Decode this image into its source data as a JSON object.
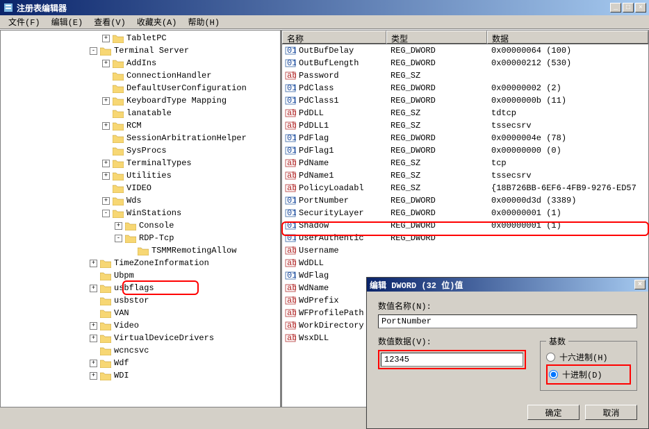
{
  "window": {
    "title": "注册表编辑器"
  },
  "menu": {
    "file": "文件(F)",
    "edit": "编辑(E)",
    "view": "查看(V)",
    "favorites": "收藏夹(A)",
    "help": "帮助(H)"
  },
  "columns": {
    "name": "名称",
    "type": "类型",
    "data": "数据"
  },
  "tree": [
    {
      "indent": 8,
      "exp": "+",
      "label": "TabletPC"
    },
    {
      "indent": 7,
      "exp": "-",
      "label": "Terminal Server"
    },
    {
      "indent": 8,
      "exp": "+",
      "label": "AddIns"
    },
    {
      "indent": 8,
      "exp": "",
      "label": "ConnectionHandler"
    },
    {
      "indent": 8,
      "exp": "",
      "label": "DefaultUserConfiguration"
    },
    {
      "indent": 8,
      "exp": "+",
      "label": "KeyboardType Mapping"
    },
    {
      "indent": 8,
      "exp": "",
      "label": "lanatable"
    },
    {
      "indent": 8,
      "exp": "+",
      "label": "RCM"
    },
    {
      "indent": 8,
      "exp": "",
      "label": "SessionArbitrationHelper"
    },
    {
      "indent": 8,
      "exp": "",
      "label": "SysProcs"
    },
    {
      "indent": 8,
      "exp": "+",
      "label": "TerminalTypes"
    },
    {
      "indent": 8,
      "exp": "+",
      "label": "Utilities"
    },
    {
      "indent": 8,
      "exp": "",
      "label": "VIDEO"
    },
    {
      "indent": 8,
      "exp": "+",
      "label": "Wds"
    },
    {
      "indent": 8,
      "exp": "-",
      "label": "WinStations"
    },
    {
      "indent": 9,
      "exp": "+",
      "label": "Console"
    },
    {
      "indent": 9,
      "exp": "-",
      "label": "RDP-Tcp"
    },
    {
      "indent": 10,
      "exp": "",
      "label": "TSMMRemotingAllow"
    },
    {
      "indent": 7,
      "exp": "+",
      "label": "TimeZoneInformation"
    },
    {
      "indent": 7,
      "exp": "",
      "label": "Ubpm"
    },
    {
      "indent": 7,
      "exp": "+",
      "label": "usbflags"
    },
    {
      "indent": 7,
      "exp": "",
      "label": "usbstor"
    },
    {
      "indent": 7,
      "exp": "",
      "label": "VAN"
    },
    {
      "indent": 7,
      "exp": "+",
      "label": "Video"
    },
    {
      "indent": 7,
      "exp": "+",
      "label": "VirtualDeviceDrivers"
    },
    {
      "indent": 7,
      "exp": "",
      "label": "wcncsvc"
    },
    {
      "indent": 7,
      "exp": "+",
      "label": "Wdf"
    },
    {
      "indent": 7,
      "exp": "+",
      "label": "WDI"
    }
  ],
  "values": [
    {
      "icon": "dword",
      "name": "OutBufDelay",
      "type": "REG_DWORD",
      "data": "0x00000064 (100)"
    },
    {
      "icon": "dword",
      "name": "OutBufLength",
      "type": "REG_DWORD",
      "data": "0x00000212 (530)"
    },
    {
      "icon": "sz",
      "name": "Password",
      "type": "REG_SZ",
      "data": ""
    },
    {
      "icon": "dword",
      "name": "PdClass",
      "type": "REG_DWORD",
      "data": "0x00000002 (2)"
    },
    {
      "icon": "dword",
      "name": "PdClass1",
      "type": "REG_DWORD",
      "data": "0x0000000b (11)"
    },
    {
      "icon": "sz",
      "name": "PdDLL",
      "type": "REG_SZ",
      "data": "tdtcp"
    },
    {
      "icon": "sz",
      "name": "PdDLL1",
      "type": "REG_SZ",
      "data": "tssecsrv"
    },
    {
      "icon": "dword",
      "name": "PdFlag",
      "type": "REG_DWORD",
      "data": "0x0000004e (78)"
    },
    {
      "icon": "dword",
      "name": "PdFlag1",
      "type": "REG_DWORD",
      "data": "0x00000000 (0)"
    },
    {
      "icon": "sz",
      "name": "PdName",
      "type": "REG_SZ",
      "data": "tcp"
    },
    {
      "icon": "sz",
      "name": "PdName1",
      "type": "REG_SZ",
      "data": "tssecsrv"
    },
    {
      "icon": "sz",
      "name": "PolicyLoadabl",
      "type": "REG_SZ",
      "data": "{18B726BB-6EF6-4FB9-9276-ED57"
    },
    {
      "icon": "dword",
      "name": "PortNumber",
      "type": "REG_DWORD",
      "data": "0x00000d3d (3389)"
    },
    {
      "icon": "dword",
      "name": "SecurityLayer",
      "type": "REG_DWORD",
      "data": "0x00000001 (1)"
    },
    {
      "icon": "dword",
      "name": "Shadow",
      "type": "REG_DWORD",
      "data": "0x00000001 (1)"
    },
    {
      "icon": "dword",
      "name": "UserAuthentic",
      "type": "REG_DWORD",
      "data": ""
    },
    {
      "icon": "sz",
      "name": "Username",
      "type": "",
      "data": ""
    },
    {
      "icon": "sz",
      "name": "WdDLL",
      "type": "",
      "data": ""
    },
    {
      "icon": "dword",
      "name": "WdFlag",
      "type": "",
      "data": ""
    },
    {
      "icon": "sz",
      "name": "WdName",
      "type": "",
      "data": ""
    },
    {
      "icon": "sz",
      "name": "WdPrefix",
      "type": "",
      "data": ""
    },
    {
      "icon": "sz",
      "name": "WFProfilePath",
      "type": "",
      "data": ""
    },
    {
      "icon": "sz",
      "name": "WorkDirectory",
      "type": "",
      "data": ""
    },
    {
      "icon": "sz",
      "name": "WsxDLL",
      "type": "",
      "data": ""
    }
  ],
  "dialog": {
    "title": "编辑 DWORD (32 位)值",
    "name_label": "数值名称(N):",
    "name_value": "PortNumber",
    "data_label": "数值数据(V):",
    "data_value": "12345",
    "base_label": "基数",
    "hex_label": "十六进制(H)",
    "dec_label": "十进制(D)",
    "ok": "确定",
    "cancel": "取消"
  }
}
